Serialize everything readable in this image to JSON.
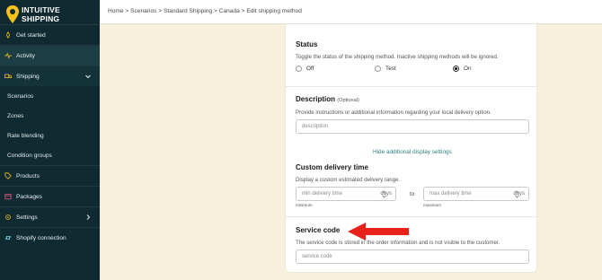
{
  "app": {
    "brand_line1": "INTUITIVE",
    "brand_line2": "SHIPPING",
    "brand_color": "#f6c21a"
  },
  "sidebar": {
    "items": [
      {
        "label": "Get started",
        "icon": "rocket-icon"
      },
      {
        "label": "Activity",
        "icon": "pulse-icon"
      },
      {
        "label": "Shipping",
        "icon": "truck-icon"
      },
      {
        "label": "Scenarios"
      },
      {
        "label": "Zones"
      },
      {
        "label": "Rate blending"
      },
      {
        "label": "Condition groups"
      },
      {
        "label": "Products",
        "icon": "tag-icon"
      },
      {
        "label": "Packages",
        "icon": "box-icon"
      },
      {
        "label": "Settings",
        "icon": "gear-icon"
      },
      {
        "label": "Shopify connection",
        "icon": "link-icon"
      }
    ]
  },
  "breadcrumb": "Home > Scenarios > Standard Shipping > Canada > Edit shipping method",
  "status": {
    "title": "Status",
    "desc": "Toggle the status of the shipping method. Inactive shipping methods will be ignored.",
    "options": [
      "Off",
      "Test",
      "On"
    ],
    "selected": "On"
  },
  "description": {
    "title": "Description",
    "optional": "(Optional)",
    "desc": "Provide instructions or additional information regarding your local delivery option.",
    "placeholder": "description"
  },
  "toggle_link": "Hide additional display settings",
  "delivery_time": {
    "title": "Custom delivery time",
    "desc": "Display a custom estimated delivery range.",
    "min_placeholder": "min delivery time",
    "max_placeholder": "max delivery time",
    "unit": "days",
    "to": "to",
    "min_caption": "minimum",
    "max_caption": "maximum"
  },
  "service_code": {
    "title": "Service code",
    "desc": "The service code is stored in the order information and is not visible to the customer.",
    "placeholder": "service code"
  },
  "colors": {
    "sidebar_bg": "#0f2a30",
    "page_bg": "#f6f0dc",
    "link": "#2a7f86",
    "arrow": "#e8211b"
  }
}
